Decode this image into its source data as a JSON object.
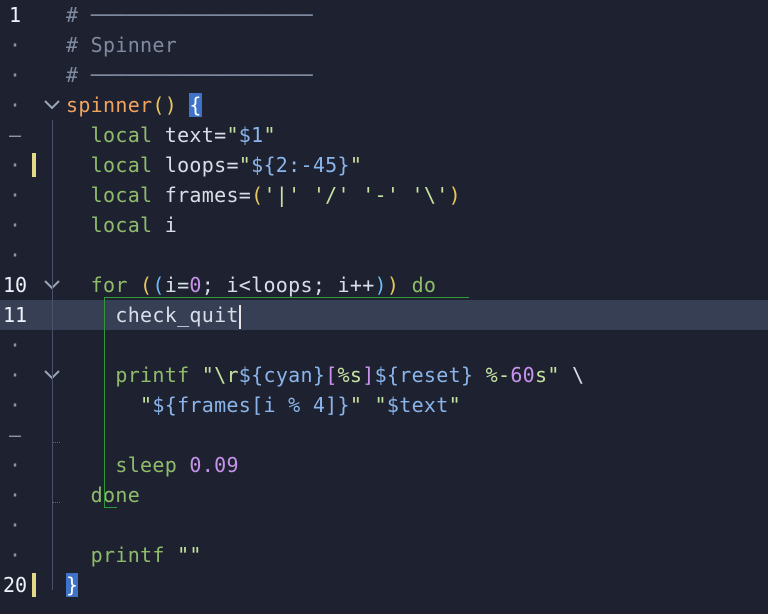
{
  "editor": {
    "language": "bash",
    "colors": {
      "background": "#1e2230",
      "current_line": "#373f55",
      "comment": "#7f8aa0",
      "function": "#f0a35e",
      "keyword": "#8fbc6b",
      "string": "#c6e2a0",
      "variable": "#8ab4ea",
      "number": "#c792ea",
      "git_modified": "#e3d98a",
      "scope_outline": "#2f9a3a"
    },
    "gutter": [
      {
        "label": "1",
        "kind": "number"
      },
      {
        "label": "·",
        "kind": "dot"
      },
      {
        "label": "·",
        "kind": "dot"
      },
      {
        "label": "·",
        "kind": "dot",
        "fold": "chevron-down"
      },
      {
        "label": "–",
        "kind": "dash"
      },
      {
        "label": "·",
        "kind": "dot",
        "git": "modified"
      },
      {
        "label": "·",
        "kind": "dot"
      },
      {
        "label": "·",
        "kind": "dot"
      },
      {
        "label": "·",
        "kind": "dot"
      },
      {
        "label": "10",
        "kind": "number",
        "fold": "chevron-down"
      },
      {
        "label": "11",
        "kind": "number",
        "current": true
      },
      {
        "label": "·",
        "kind": "dot"
      },
      {
        "label": "·",
        "kind": "dot",
        "fold": "chevron-down"
      },
      {
        "label": "·",
        "kind": "dot"
      },
      {
        "label": "–",
        "kind": "dash"
      },
      {
        "label": "·",
        "kind": "dot"
      },
      {
        "label": "·",
        "kind": "dot"
      },
      {
        "label": "·",
        "kind": "dot"
      },
      {
        "label": "·",
        "kind": "dot"
      },
      {
        "label": "20",
        "kind": "number",
        "git": "modified"
      }
    ],
    "lines": [
      [
        {
          "t": "# ",
          "c": "cm"
        },
        {
          "t": "──────────────────",
          "c": "cm"
        }
      ],
      [
        {
          "t": "# Spinner",
          "c": "cm"
        }
      ],
      [
        {
          "t": "# ",
          "c": "cm"
        },
        {
          "t": "──────────────────",
          "c": "cm"
        }
      ],
      [
        {
          "t": "spinner",
          "c": "fn"
        },
        {
          "t": "()",
          "c": "br1"
        },
        {
          "t": " ",
          "c": ""
        },
        {
          "t": "{",
          "c": "cur-brace"
        }
      ],
      [
        {
          "t": "  local ",
          "c": "kw"
        },
        {
          "t": "text=",
          "c": ""
        },
        {
          "t": "\"",
          "c": "str"
        },
        {
          "t": "$1",
          "c": "var"
        },
        {
          "t": "\"",
          "c": "str"
        }
      ],
      [
        {
          "t": "  local ",
          "c": "kw"
        },
        {
          "t": "loops=",
          "c": ""
        },
        {
          "t": "\"",
          "c": "str"
        },
        {
          "t": "${2:-45}",
          "c": "var"
        },
        {
          "t": "\"",
          "c": "str"
        }
      ],
      [
        {
          "t": "  local ",
          "c": "kw"
        },
        {
          "t": "frames=",
          "c": ""
        },
        {
          "t": "(",
          "c": "br1"
        },
        {
          "t": "'|' '/' '-' '\\'",
          "c": "str"
        },
        {
          "t": ")",
          "c": "br1"
        }
      ],
      [
        {
          "t": "  local ",
          "c": "kw"
        },
        {
          "t": "i",
          "c": ""
        }
      ],
      [],
      [
        {
          "t": "  for ",
          "c": "kw"
        },
        {
          "t": "(",
          "c": "br1"
        },
        {
          "t": "(",
          "c": "br3"
        },
        {
          "t": "i=",
          "c": ""
        },
        {
          "t": "0",
          "c": "num"
        },
        {
          "t": "; i<loops; i++",
          "c": ""
        },
        {
          "t": ")",
          "c": "br3"
        },
        {
          "t": ")",
          "c": "br1"
        },
        {
          "t": " do",
          "c": "kw"
        }
      ],
      [
        {
          "t": "    check_quit",
          "c": ""
        },
        {
          "t": "",
          "c": "caret"
        }
      ],
      [],
      [
        {
          "t": "    printf ",
          "c": "kw"
        },
        {
          "t": "\"\\r",
          "c": "str"
        },
        {
          "t": "${cyan}",
          "c": "var"
        },
        {
          "t": "[",
          "c": "br2"
        },
        {
          "t": "%s",
          "c": "str"
        },
        {
          "t": "]",
          "c": "br2"
        },
        {
          "t": "${reset}",
          "c": "var"
        },
        {
          "t": " %-",
          "c": "str"
        },
        {
          "t": "60",
          "c": "num"
        },
        {
          "t": "s\" ",
          "c": "str"
        },
        {
          "t": "\\",
          "c": ""
        }
      ],
      [
        {
          "t": "      \"",
          "c": "str"
        },
        {
          "t": "${frames[i % 4]}",
          "c": "var"
        },
        {
          "t": "\" \"",
          "c": "str"
        },
        {
          "t": "$text",
          "c": "var"
        },
        {
          "t": "\"",
          "c": "str"
        }
      ],
      [],
      [
        {
          "t": "    sleep ",
          "c": "kw"
        },
        {
          "t": "0.09",
          "c": "num"
        }
      ],
      [
        {
          "t": "  done",
          "c": "kw"
        }
      ],
      [],
      [
        {
          "t": "  printf ",
          "c": "kw"
        },
        {
          "t": "\"\"",
          "c": "str"
        }
      ],
      [
        {
          "t": "}",
          "c": "cur-brace"
        }
      ]
    ]
  }
}
